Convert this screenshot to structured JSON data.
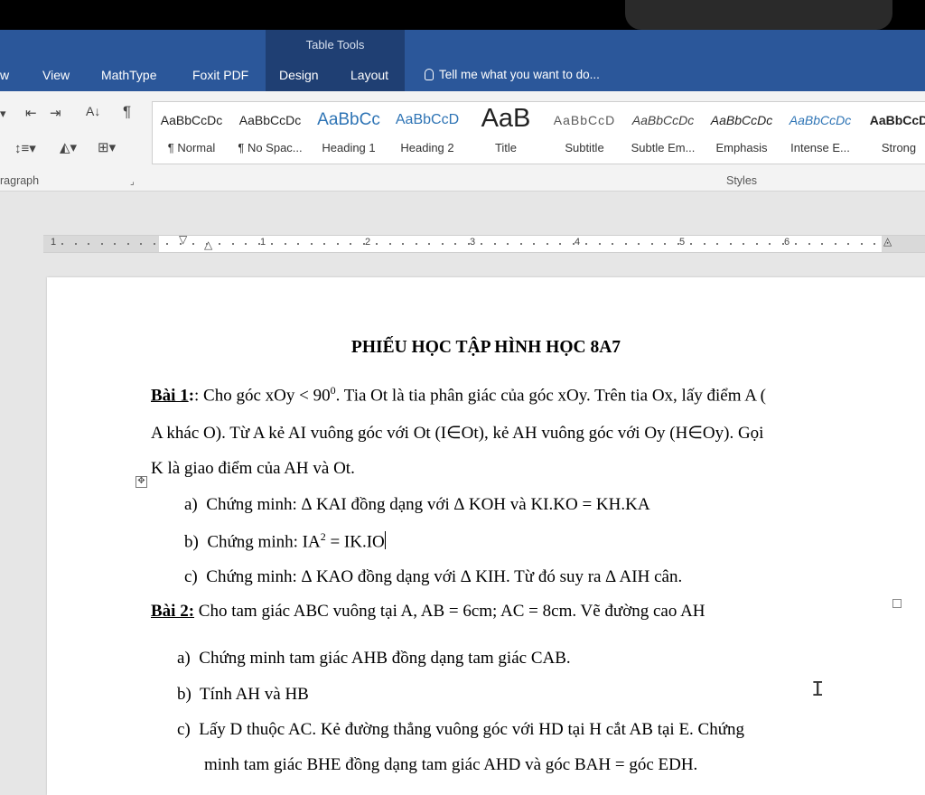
{
  "ribbon": {
    "context_group": "Table Tools",
    "tabs": [
      "w",
      "View",
      "MathType",
      "Foxit PDF",
      "Design",
      "Layout"
    ],
    "tell_me": "Tell me what you want to do...",
    "paragraph_label": "ragraph",
    "styles_label": "Styles",
    "styles": [
      {
        "preview": "AaBbCcDc",
        "name": "¶ Normal"
      },
      {
        "preview": "AaBbCcDc",
        "name": "¶ No Spac..."
      },
      {
        "preview": "AaBbCc",
        "name": "Heading 1"
      },
      {
        "preview": "AaBbCcD",
        "name": "Heading 2"
      },
      {
        "preview": "AaB",
        "name": "Title"
      },
      {
        "preview": "AaBbCcD",
        "name": "Subtitle"
      },
      {
        "preview": "AaBbCcDc",
        "name": "Subtle Em..."
      },
      {
        "preview": "AaBbCcDc",
        "name": "Emphasis"
      },
      {
        "preview": "AaBbCcDc",
        "name": "Intense E..."
      },
      {
        "preview": "AaBbCcD",
        "name": "Strong"
      }
    ],
    "colors": {
      "brand": "#2b579a",
      "context": "#1f3f73",
      "heading_preview": "#2e74b5"
    }
  },
  "ruler": {
    "numbers": [
      "1",
      "1",
      "2",
      "3",
      "4",
      "5",
      "6"
    ]
  },
  "document": {
    "title": "PHIẾU HỌC TẬP HÌNH HỌC 8A7",
    "bai1": {
      "label": "Bài 1",
      "line1": ": Cho góc xOy < 90",
      "line1_sup": "0",
      "line1_rest": ". Tia Ot là tia phân giác của góc xOy. Trên tia Ox, lấy điểm A (",
      "line2": "A khác O). Từ A kẻ AI vuông góc với Ot (I∈Ot), kẻ AH vuông góc với Oy (H∈Oy). Gọi",
      "line3": "K là giao điểm của AH và Ot.",
      "items": [
        {
          "marker": "a)",
          "text": "Chứng minh: ∆ KAI đồng dạng với ∆ KOH và KI.KO = KH.KA"
        },
        {
          "marker": "b)",
          "text": "Chứng minh: IA",
          "sup": "2",
          "rest": " = IK.IO"
        },
        {
          "marker": "c)",
          "text": "Chứng minh: ∆ KAO đồng dạng với ∆ KIH. Từ đó suy ra ∆ AIH cân."
        }
      ]
    },
    "bai2": {
      "label": "Bài 2:",
      "line1": " Cho tam giác ABC vuông tại A, AB = 6cm; AC = 8cm. Vẽ đường cao AH",
      "items": [
        {
          "marker": "a)",
          "text": "Chứng minh tam giác AHB đồng dạng tam giác CAB."
        },
        {
          "marker": "b)",
          "text": "Tính AH và HB"
        },
        {
          "marker": "c)",
          "text": "Lấy D thuộc AC. Kẻ đường thẳng vuông góc với HD tại H cắt AB tại E. Chứng"
        }
      ],
      "cont": "minh tam giác BHE đồng dạng tam giác AHD và góc BAH = góc EDH."
    }
  }
}
